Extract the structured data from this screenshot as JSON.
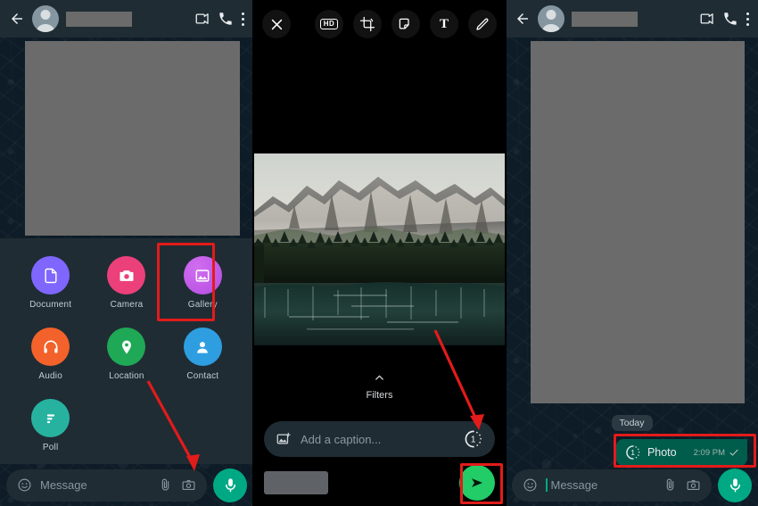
{
  "panel1": {
    "header": {
      "back_icon": "back-arrow-icon",
      "avatar": "contact-avatar",
      "contact_name": "",
      "video_call_icon": "video-call-icon",
      "voice_call_icon": "phone-call-icon",
      "menu_icon": "overflow-menu-icon"
    },
    "attachment_sheet": {
      "items": [
        {
          "label": "Document",
          "icon": "document-icon",
          "color": "#7f66ff"
        },
        {
          "label": "Camera",
          "icon": "camera-icon",
          "color": "#ec407a"
        },
        {
          "label": "Gallery",
          "icon": "gallery-icon",
          "color": "#c557e8",
          "highlighted": true
        },
        {
          "label": "Audio",
          "icon": "headphones-icon",
          "color": "#f2622a"
        },
        {
          "label": "Location",
          "icon": "location-pin-icon",
          "color": "#1fa855"
        },
        {
          "label": "Contact",
          "icon": "person-icon",
          "color": "#2e9ee0"
        },
        {
          "label": "Poll",
          "icon": "poll-icon",
          "color": "#27b2a0"
        }
      ]
    },
    "input_bar": {
      "emoji_icon": "emoji-smiley-icon",
      "placeholder": "Message",
      "attach_icon": "paperclip-icon",
      "camera_icon": "camera-icon",
      "mic_icon": "microphone-icon"
    }
  },
  "panel2": {
    "toolbar": {
      "close_icon": "close-x-icon",
      "hd_label": "HD",
      "crop_icon": "crop-rotate-icon",
      "sticker_icon": "sticker-icon",
      "text_label": "T",
      "draw_icon": "pencil-draw-icon"
    },
    "photo": {
      "alt": "mountain-lake-photo"
    },
    "filters": {
      "chevron_icon": "chevron-up-icon",
      "label": "Filters"
    },
    "caption": {
      "image_icon": "add-photo-icon",
      "placeholder": "Add a caption...",
      "view_once_icon": "view-once-icon",
      "view_once_label": "1"
    },
    "send_row": {
      "recipient_chip": "",
      "send_icon": "send-arrow-icon",
      "send_highlighted": true
    }
  },
  "panel3": {
    "header": {
      "back_icon": "back-arrow-icon",
      "avatar": "contact-avatar",
      "contact_name": "",
      "video_call_icon": "video-call-icon",
      "voice_call_icon": "phone-call-icon",
      "menu_icon": "overflow-menu-icon"
    },
    "day_divider": "Today",
    "message": {
      "view_once_icon": "view-once-icon",
      "view_once_label": "1",
      "label": "Photo",
      "time": "2:09 PM",
      "status_icon": "sent-check-icon",
      "highlighted": true
    },
    "input_bar": {
      "emoji_icon": "emoji-smiley-icon",
      "placeholder": "Message",
      "attach_icon": "paperclip-icon",
      "camera_icon": "camera-icon",
      "mic_icon": "microphone-icon"
    }
  },
  "annotations": {
    "arrow_color": "#e21b1b",
    "arrow1": "arrow-to-camera-icon",
    "arrow2": "arrow-to-view-once-icon",
    "highlight_color": "#e21b1b"
  }
}
